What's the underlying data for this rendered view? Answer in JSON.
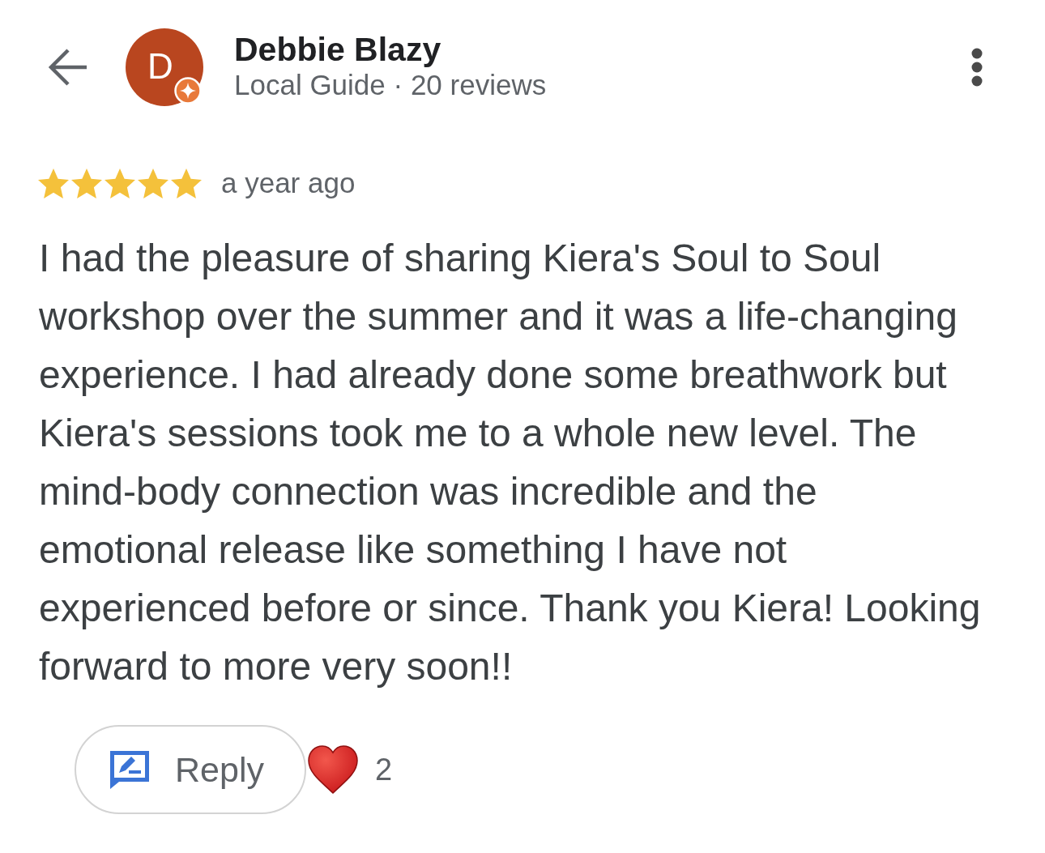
{
  "header": {
    "name": "Debbie Blazy",
    "avatar_letter": "D",
    "local_guide": true,
    "subtitle": "Local Guide · 20 reviews"
  },
  "rating": {
    "stars": 5,
    "time": "a year ago"
  },
  "review": "I had the pleasure of sharing Kiera's Soul to Soul workshop over the summer and it was a life-changing experience. I had already done some breathwork but Kiera's sessions took me to a whole new level. The mind-body connection was incredible and the emotional release like something I have not experienced before or since. Thank you Kiera! Looking forward to more very soon!!",
  "actions": {
    "reply": "Reply",
    "reaction_count": "2"
  }
}
